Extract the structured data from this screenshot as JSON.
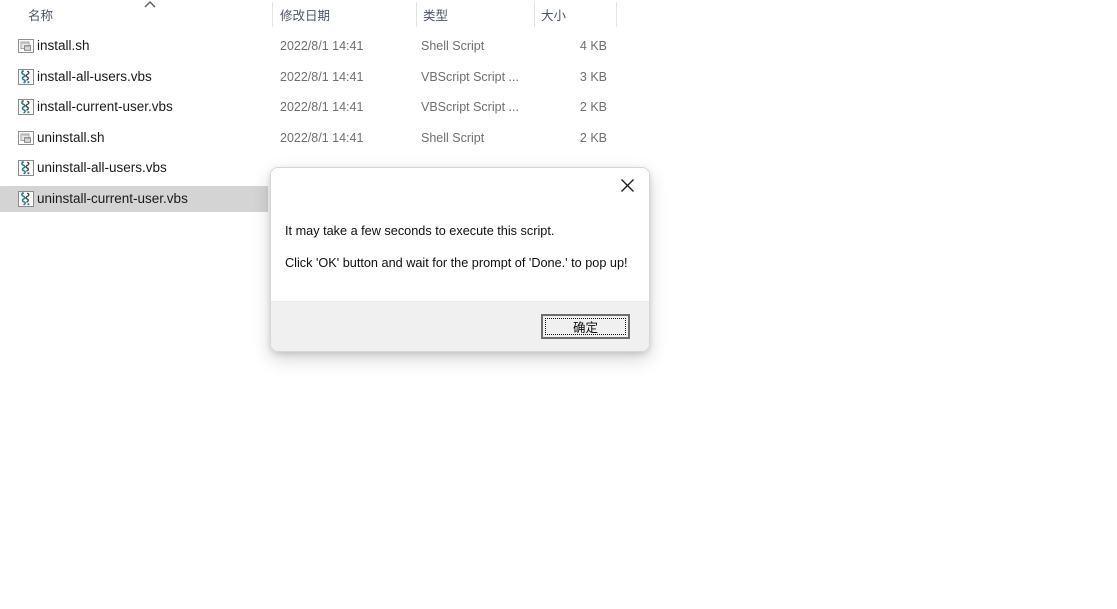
{
  "window": {
    "type": "file-explorer-details-view"
  },
  "explorer": {
    "columns": [
      {
        "key": "name",
        "label": "名称",
        "sorted": true,
        "sort_direction": "ascending"
      },
      {
        "key": "date",
        "label": "修改日期"
      },
      {
        "key": "type",
        "label": "类型"
      },
      {
        "key": "size",
        "label": "大小"
      }
    ],
    "rows": [
      {
        "icon": "shell-script-file-icon",
        "name": "install.sh",
        "date": "2022/8/1 14:41",
        "type": "Shell Script",
        "size": "4 KB",
        "selected": false
      },
      {
        "icon": "vbscript-file-icon",
        "name": "install-all-users.vbs",
        "date": "2022/8/1 14:41",
        "type": "VBScript Script ...",
        "size": "3 KB",
        "selected": false
      },
      {
        "icon": "vbscript-file-icon",
        "name": "install-current-user.vbs",
        "date": "2022/8/1 14:41",
        "type": "VBScript Script ...",
        "size": "2 KB",
        "selected": false
      },
      {
        "icon": "shell-script-file-icon",
        "name": "uninstall.sh",
        "date": "2022/8/1 14:41",
        "type": "Shell Script",
        "size": "2 KB",
        "selected": false
      },
      {
        "icon": "vbscript-file-icon",
        "name": "uninstall-all-users.vbs",
        "date": "",
        "type": "",
        "size": "",
        "selected": false
      },
      {
        "icon": "vbscript-file-icon",
        "name": "uninstall-current-user.vbs",
        "date": "",
        "type": "",
        "size": "",
        "selected": true
      }
    ]
  },
  "dialog": {
    "close_icon": "close-icon",
    "message_line_1": "It may take a few seconds to execute this script.",
    "message_line_2": "Click 'OK' button and wait for the prompt of 'Done.' to pop up!",
    "ok_label": "确定"
  },
  "colors": {
    "selection": "#d4d4d4",
    "header_text": "#4a5568",
    "secondary_text": "#6f6f6f",
    "dialog_footer": "#f0f0f0"
  }
}
